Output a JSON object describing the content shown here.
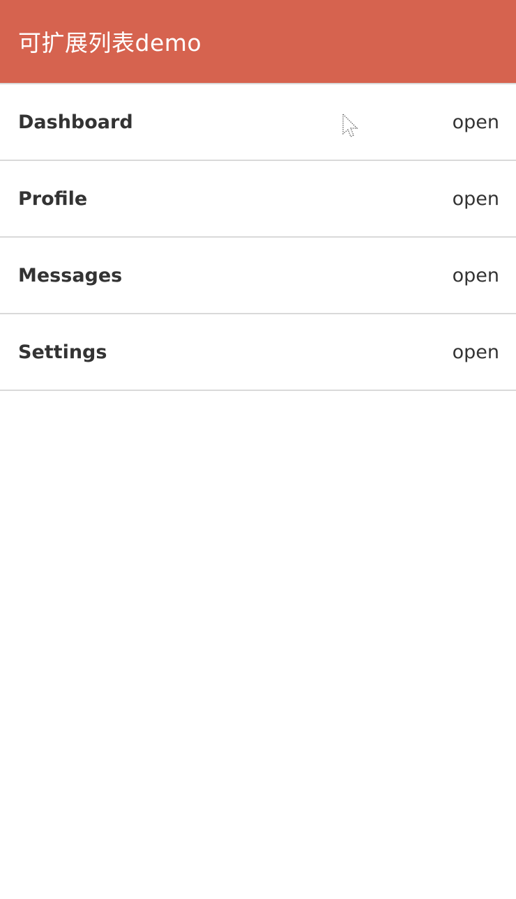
{
  "header": {
    "title": "可扩展列表demo"
  },
  "list": {
    "items": [
      {
        "label": "Dashboard",
        "action": "open"
      },
      {
        "label": "Profile",
        "action": "open"
      },
      {
        "label": "Messages",
        "action": "open"
      },
      {
        "label": "Settings",
        "action": "open"
      }
    ]
  },
  "colors": {
    "header_bg": "#d6634f",
    "header_text": "#ffffff",
    "item_text": "#333333",
    "divider": "#d9d9d9"
  }
}
